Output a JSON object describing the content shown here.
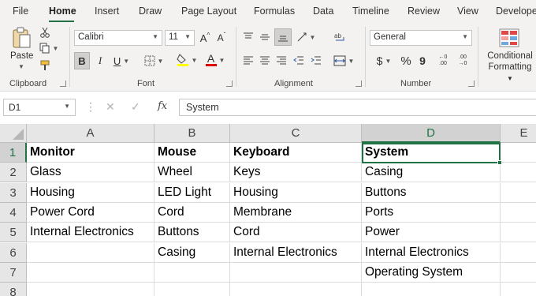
{
  "menu": {
    "tabs": [
      "File",
      "Home",
      "Insert",
      "Draw",
      "Page Layout",
      "Formulas",
      "Data",
      "Timeline",
      "Review",
      "View",
      "Develope"
    ]
  },
  "ribbon": {
    "clipboard": {
      "paste_label": "Paste",
      "group_label": "Clipboard"
    },
    "font": {
      "font_name": "Calibri",
      "font_size": "11",
      "bold": "B",
      "italic": "I",
      "underline": "U",
      "grow": "A",
      "shrink": "A",
      "font_color": "A",
      "group_label": "Font"
    },
    "alignment": {
      "group_label": "Alignment"
    },
    "number": {
      "format": "General",
      "currency": "$",
      "percent": "%",
      "comma": "9",
      "inc_decimal": "←0 .00",
      "dec_decimal": ".00 →0",
      "group_label": "Number"
    },
    "styles": {
      "conditional_formatting": "Conditional Formatting"
    }
  },
  "formula_bar": {
    "name_box": "D1",
    "fx": "fx",
    "content": "System"
  },
  "sheet": {
    "columns": [
      "A",
      "B",
      "C",
      "D",
      "E"
    ],
    "rows": [
      "1",
      "2",
      "3",
      "4",
      "5",
      "6",
      "7",
      "8"
    ],
    "selected_cell": "D1",
    "cells": [
      [
        "Monitor",
        "Mouse",
        "Keyboard",
        "System"
      ],
      [
        "Glass",
        "Wheel",
        "Keys",
        "Casing"
      ],
      [
        "Housing",
        "LED Light",
        "Housing",
        "Buttons"
      ],
      [
        "Power Cord",
        "Cord",
        "Membrane",
        "Ports"
      ],
      [
        "Internal Electronics",
        "Buttons",
        "Cord",
        "Power"
      ],
      [
        "",
        "Casing",
        "Internal Electronics",
        "Internal Electronics"
      ],
      [
        "",
        "",
        "",
        "Operating System"
      ],
      [
        "",
        "",
        "",
        ""
      ]
    ]
  },
  "colors": {
    "accent": "#217346",
    "ribbon_bg": "#f3f2f1",
    "header_bg": "#e6e6e6"
  }
}
